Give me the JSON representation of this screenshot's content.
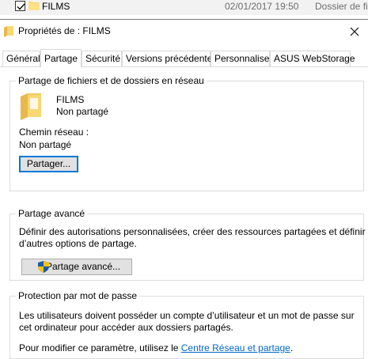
{
  "explorer_row": {
    "name": "FILMS",
    "date": "02/01/2017 19:50",
    "type": "Dossier de fic"
  },
  "dialog": {
    "title": "Propriétés de : FILMS"
  },
  "tabs": [
    {
      "label": "Général"
    },
    {
      "label": "Partage"
    },
    {
      "label": "Sécurité"
    },
    {
      "label": "Versions précédentes"
    },
    {
      "label": "Personnaliser"
    },
    {
      "label": "ASUS WebStorage"
    }
  ],
  "sharing": {
    "group_title": "Partage de fichiers et de dossiers en réseau",
    "folder_name": "FILMS",
    "folder_status": "Non partagé",
    "network_path_label": "Chemin réseau :",
    "network_path_value": "Non partagé",
    "share_button": "Partager..."
  },
  "advanced": {
    "group_title": "Partage avancé",
    "description_line1": "Définir des autorisations personnalisées, créer des ressources partagées et définir",
    "description_line2": "d’autres options de partage.",
    "button": "Partage avancé..."
  },
  "password": {
    "group_title": "Protection par mot de passe",
    "description_line1": "Les utilisateurs doivent posséder un compte d’utilisateur et un mot de passe sur",
    "description_line2": "cet ordinateur pour accéder aux dossiers partagés.",
    "modify_text": "Pour modifier ce paramètre, utilisez le ",
    "link_text": "Centre Réseau et partage",
    "modify_end": "."
  },
  "colors": {
    "folder_yellow": "#f8d775",
    "link_blue": "#0066cc",
    "focus_blue": "#0078d7"
  }
}
